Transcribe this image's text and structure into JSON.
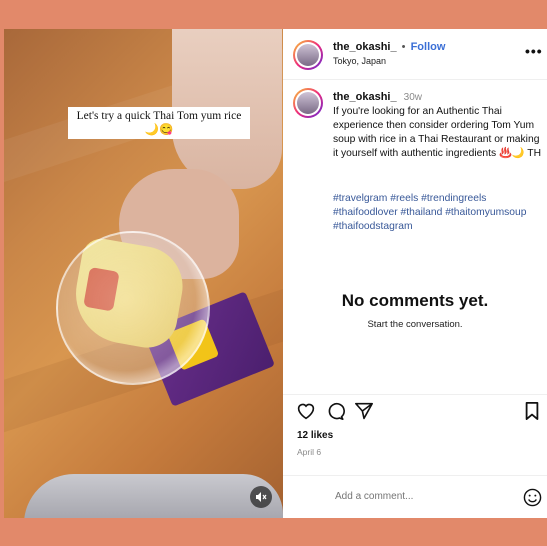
{
  "video": {
    "caption": "Let's try a quick Thai Tom yum rice 🌙😋",
    "mute_icon": "speaker-muted-icon"
  },
  "header": {
    "username": "the_okashi_",
    "separator": "•",
    "follow_label": "Follow",
    "location": "Tokyo, Japan",
    "more_icon": "•••"
  },
  "post_caption": {
    "username": "the_okashi_",
    "time": "30w",
    "text": "If you're looking for an Authentic Thai experience then consider ordering Tom Yum soup with rice in a Thai Restaurant or making it yourself with authentic ingredients ♨️🌙 TH",
    "hashtags": "#travelgram #reels #trendingreels #thaifoodlover #thailand #thaitomyumsoup #thaifoodstagram"
  },
  "comments": {
    "empty_title": "No comments yet.",
    "empty_subtitle": "Start the conversation."
  },
  "actions": {
    "likes": "12 likes",
    "date": "April 6"
  },
  "add_comment": {
    "placeholder": "Add a comment..."
  },
  "colors": {
    "background": "#e2896a",
    "follow": "#3b6fd6",
    "hashtag": "#385898"
  }
}
